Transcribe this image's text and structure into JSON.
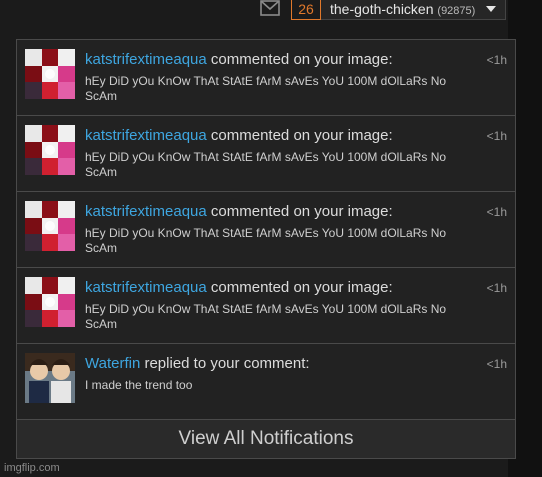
{
  "header": {
    "notification_count": "26",
    "username": "the-goth-chicken",
    "points": "(92875)"
  },
  "notifications": [
    {
      "user": "katstrifextimeaqua",
      "action": "commented on your image:",
      "text": "hEy DiD yOu KnOw ThAt StAtE fArM sAvEs YoU 100M dOlLaRs No ScAm",
      "time": "<1h",
      "thumb_icon": "collage-image-thumbnail"
    },
    {
      "user": "katstrifextimeaqua",
      "action": "commented on your image:",
      "text": "hEy DiD yOu KnOw ThAt StAtE fArM sAvEs YoU 100M dOlLaRs No ScAm",
      "time": "<1h",
      "thumb_icon": "collage-image-thumbnail"
    },
    {
      "user": "katstrifextimeaqua",
      "action": "commented on your image:",
      "text": "hEy DiD yOu KnOw ThAt StAtE fArM sAvEs YoU 100M dOlLaRs No ScAm",
      "time": "<1h",
      "thumb_icon": "collage-image-thumbnail"
    },
    {
      "user": "katstrifextimeaqua",
      "action": "commented on your image:",
      "text": "hEy DiD yOu KnOw ThAt StAtE fArM sAvEs YoU 100M dOlLaRs No ScAm",
      "time": "<1h",
      "thumb_icon": "collage-image-thumbnail"
    },
    {
      "user": "Waterfin",
      "action": "replied to your comment:",
      "text": "I made the trend too",
      "time": "<1h",
      "thumb_icon": "anime-image-thumbnail"
    }
  ],
  "view_all_label": "View All Notifications",
  "footer": "imgflip.com",
  "colors": {
    "accent_orange": "#e0782b",
    "username_blue": "#3ea6e0",
    "panel_bg": "#222222"
  }
}
